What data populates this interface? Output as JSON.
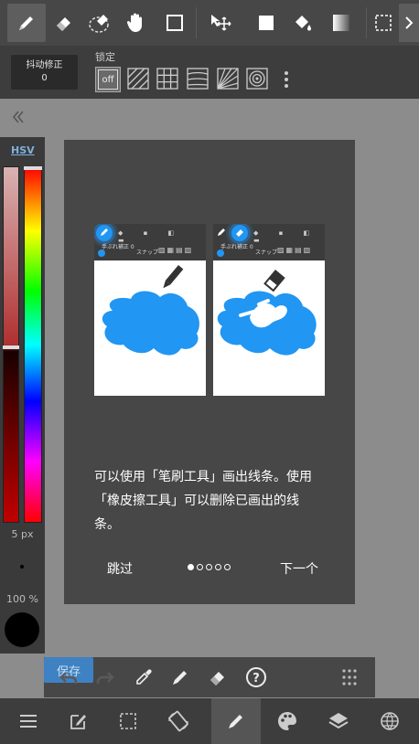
{
  "top_toolbar": {
    "tools": [
      "brush-icon",
      "eraser-icon",
      "lasso-eraser-icon",
      "hand-icon",
      "rect-icon",
      "move-icon",
      "fill-rect-icon",
      "bucket-icon",
      "gradient-icon",
      "select-rect-icon"
    ],
    "expand_icon": "chevron-right-icon"
  },
  "stabilizer": {
    "label": "抖动修正",
    "value": "0"
  },
  "snap": {
    "label": "锁定",
    "off_label": "off"
  },
  "color_panel": {
    "mode_label": "HSV",
    "brush_size": "5 px",
    "opacity": "100 %"
  },
  "tutorial": {
    "thumb_left_label": "手ぶれ補正 0",
    "thumb_left_snap": "スナップ",
    "thumb_right_label": "手ぶれ補正 0",
    "thumb_right_snap": "スナップ",
    "text_line1": "可以使用「笔刷工具」画出线条。使用",
    "text_line2": "「橡皮擦工具」可以删除已画出的线",
    "text_line3": "条。",
    "skip_label": "跳过",
    "next_label": "下一个",
    "page_count": 5,
    "current_page": 1
  },
  "bottom_tools": {
    "save_label": "保存"
  },
  "colors": {
    "accent": "#3f82c3",
    "brush_blue": "#2196F3"
  }
}
